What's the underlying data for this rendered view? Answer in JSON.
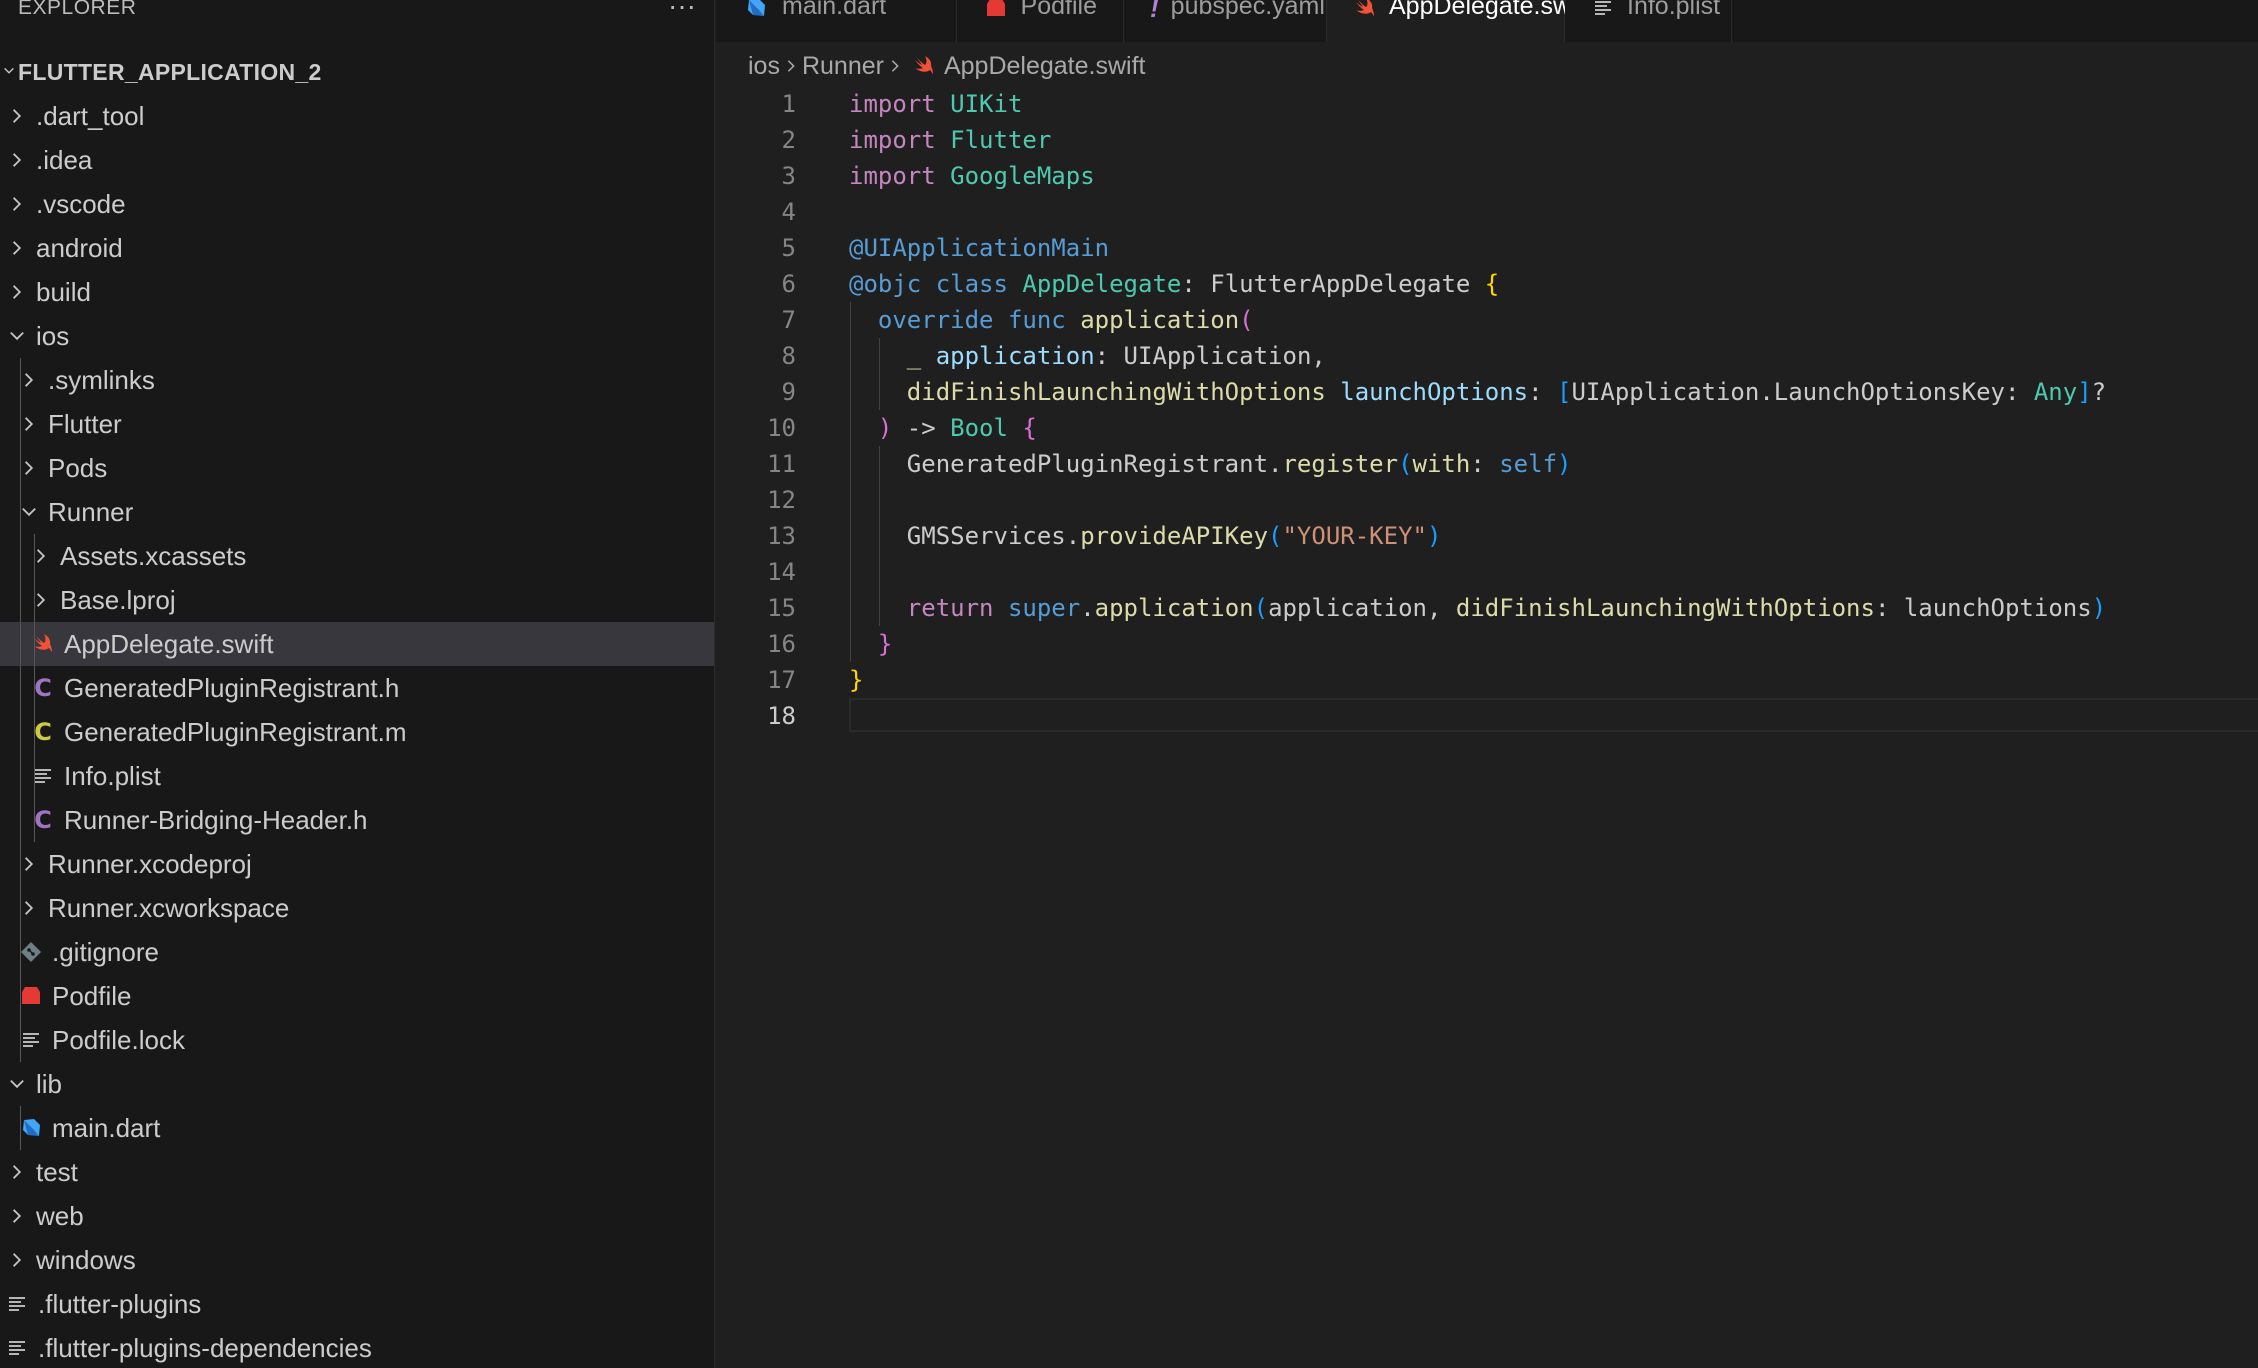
{
  "explorer": {
    "title": "EXPLORER",
    "more": "···",
    "project": "FLUTTER_APPLICATION_2",
    "items": [
      {
        "label": ".dart_tool",
        "depth": 0,
        "kind": "folder",
        "expanded": false
      },
      {
        "label": ".idea",
        "depth": 0,
        "kind": "folder",
        "expanded": false
      },
      {
        "label": ".vscode",
        "depth": 0,
        "kind": "folder",
        "expanded": false
      },
      {
        "label": "android",
        "depth": 0,
        "kind": "folder",
        "expanded": false
      },
      {
        "label": "build",
        "depth": 0,
        "kind": "folder",
        "expanded": false
      },
      {
        "label": "ios",
        "depth": 0,
        "kind": "folder",
        "expanded": true
      },
      {
        "label": ".symlinks",
        "depth": 1,
        "kind": "folder",
        "expanded": false
      },
      {
        "label": "Flutter",
        "depth": 1,
        "kind": "folder",
        "expanded": false
      },
      {
        "label": "Pods",
        "depth": 1,
        "kind": "folder",
        "expanded": false
      },
      {
        "label": "Runner",
        "depth": 1,
        "kind": "folder",
        "expanded": true
      },
      {
        "label": "Assets.xcassets",
        "depth": 2,
        "kind": "folder",
        "expanded": false
      },
      {
        "label": "Base.lproj",
        "depth": 2,
        "kind": "folder",
        "expanded": false
      },
      {
        "label": "AppDelegate.swift",
        "depth": 2,
        "kind": "swift",
        "selected": true
      },
      {
        "label": "GeneratedPluginRegistrant.h",
        "depth": 2,
        "kind": "c-header"
      },
      {
        "label": "GeneratedPluginRegistrant.m",
        "depth": 2,
        "kind": "objc"
      },
      {
        "label": "Info.plist",
        "depth": 2,
        "kind": "plist"
      },
      {
        "label": "Runner-Bridging-Header.h",
        "depth": 2,
        "kind": "c-header"
      },
      {
        "label": "Runner.xcodeproj",
        "depth": 1,
        "kind": "folder",
        "expanded": false
      },
      {
        "label": "Runner.xcworkspace",
        "depth": 1,
        "kind": "folder",
        "expanded": false
      },
      {
        "label": ".gitignore",
        "depth": 1,
        "kind": "git"
      },
      {
        "label": "Podfile",
        "depth": 1,
        "kind": "ruby"
      },
      {
        "label": "Podfile.lock",
        "depth": 1,
        "kind": "plist"
      },
      {
        "label": "lib",
        "depth": 0,
        "kind": "folder",
        "expanded": true
      },
      {
        "label": "main.dart",
        "depth": 1,
        "kind": "dart"
      },
      {
        "label": "test",
        "depth": 0,
        "kind": "folder",
        "expanded": false
      },
      {
        "label": "web",
        "depth": 0,
        "kind": "folder",
        "expanded": false
      },
      {
        "label": "windows",
        "depth": 0,
        "kind": "folder",
        "expanded": false
      },
      {
        "label": ".flutter-plugins",
        "depth": 0,
        "kind": "plist"
      },
      {
        "label": ".flutter-plugins-dependencies",
        "depth": 0,
        "kind": "plist"
      }
    ]
  },
  "tabs": [
    {
      "label": "main.dart",
      "kind": "dart",
      "active": false
    },
    {
      "label": "Podfile",
      "kind": "ruby",
      "active": false
    },
    {
      "label": "pubspec.yaml",
      "kind": "yaml",
      "active": false
    },
    {
      "label": "AppDelegate.swift",
      "kind": "swift",
      "active": true,
      "modified": true
    },
    {
      "label": "Info.plist",
      "kind": "plist",
      "active": false
    }
  ],
  "breadcrumb": {
    "parts": [
      "ios",
      "Runner"
    ],
    "file": "AppDelegate.swift"
  },
  "editor": {
    "current_line": 18,
    "lines": [
      [
        [
          "kw",
          "import"
        ],
        [
          "pl",
          " "
        ],
        [
          "ty",
          "UIKit"
        ]
      ],
      [
        [
          "kw",
          "import"
        ],
        [
          "pl",
          " "
        ],
        [
          "ty",
          "Flutter"
        ]
      ],
      [
        [
          "kw",
          "import"
        ],
        [
          "pl",
          " "
        ],
        [
          "ty",
          "GoogleMaps"
        ]
      ],
      [],
      [
        [
          "kw2",
          "@UIApplicationMain"
        ]
      ],
      [
        [
          "kw2",
          "@objc"
        ],
        [
          "pl",
          " "
        ],
        [
          "kw2",
          "class"
        ],
        [
          "pl",
          " "
        ],
        [
          "ty",
          "AppDelegate"
        ],
        [
          "pl",
          ": FlutterAppDelegate "
        ],
        [
          "b1",
          "{"
        ]
      ],
      [
        [
          "pl",
          "  "
        ],
        [
          "kw2",
          "override"
        ],
        [
          "pl",
          " "
        ],
        [
          "kw2",
          "func"
        ],
        [
          "pl",
          " "
        ],
        [
          "fn",
          "application"
        ],
        [
          "b2",
          "("
        ]
      ],
      [
        [
          "pl",
          "    "
        ],
        [
          "fn",
          "_"
        ],
        [
          "pl",
          " "
        ],
        [
          "pm",
          "application"
        ],
        [
          "pl",
          ": UIApplication,"
        ]
      ],
      [
        [
          "pl",
          "    "
        ],
        [
          "fn",
          "didFinishLaunchingWithOptions"
        ],
        [
          "pl",
          " "
        ],
        [
          "pm",
          "launchOptions"
        ],
        [
          "pl",
          ": "
        ],
        [
          "b3",
          "["
        ],
        [
          "pl",
          "UIApplication.LaunchOptionsKey: "
        ],
        [
          "ty",
          "Any"
        ],
        [
          "b3",
          "]"
        ],
        [
          "pl",
          "?"
        ]
      ],
      [
        [
          "pl",
          "  "
        ],
        [
          "b2",
          ")"
        ],
        [
          "pl",
          " -> "
        ],
        [
          "ty",
          "Bool"
        ],
        [
          "pl",
          " "
        ],
        [
          "b2",
          "{"
        ]
      ],
      [
        [
          "pl",
          "    GeneratedPluginRegistrant."
        ],
        [
          "fn",
          "register"
        ],
        [
          "b3",
          "("
        ],
        [
          "fn",
          "with"
        ],
        [
          "pl",
          ": "
        ],
        [
          "kw2",
          "self"
        ],
        [
          "b3",
          ")"
        ]
      ],
      [],
      [
        [
          "pl",
          "    GMSServices."
        ],
        [
          "fn",
          "provideAPIKey"
        ],
        [
          "b3",
          "("
        ],
        [
          "st",
          "\"YOUR-KEY\""
        ],
        [
          "b3",
          ")"
        ]
      ],
      [],
      [
        [
          "pl",
          "    "
        ],
        [
          "kw",
          "return"
        ],
        [
          "pl",
          " "
        ],
        [
          "kw2",
          "super"
        ],
        [
          "pl",
          "."
        ],
        [
          "fn",
          "application"
        ],
        [
          "b3",
          "("
        ],
        [
          "pl",
          "application, "
        ],
        [
          "fn",
          "didFinishLaunchingWithOptions"
        ],
        [
          "pl",
          ": launchOptions"
        ],
        [
          "b3",
          ")"
        ]
      ],
      [
        [
          "pl",
          "  "
        ],
        [
          "b2",
          "}"
        ]
      ],
      [
        [
          "b1",
          "}"
        ]
      ],
      []
    ]
  },
  "colors": {
    "swift": "#f05138",
    "dart": "#42a5f5",
    "ruby": "#e53935",
    "yaml": "#b180d7",
    "c-header": "#a074c4",
    "objc": "#cbcb41",
    "git": "#6d8086",
    "plist": "#cccccc"
  }
}
